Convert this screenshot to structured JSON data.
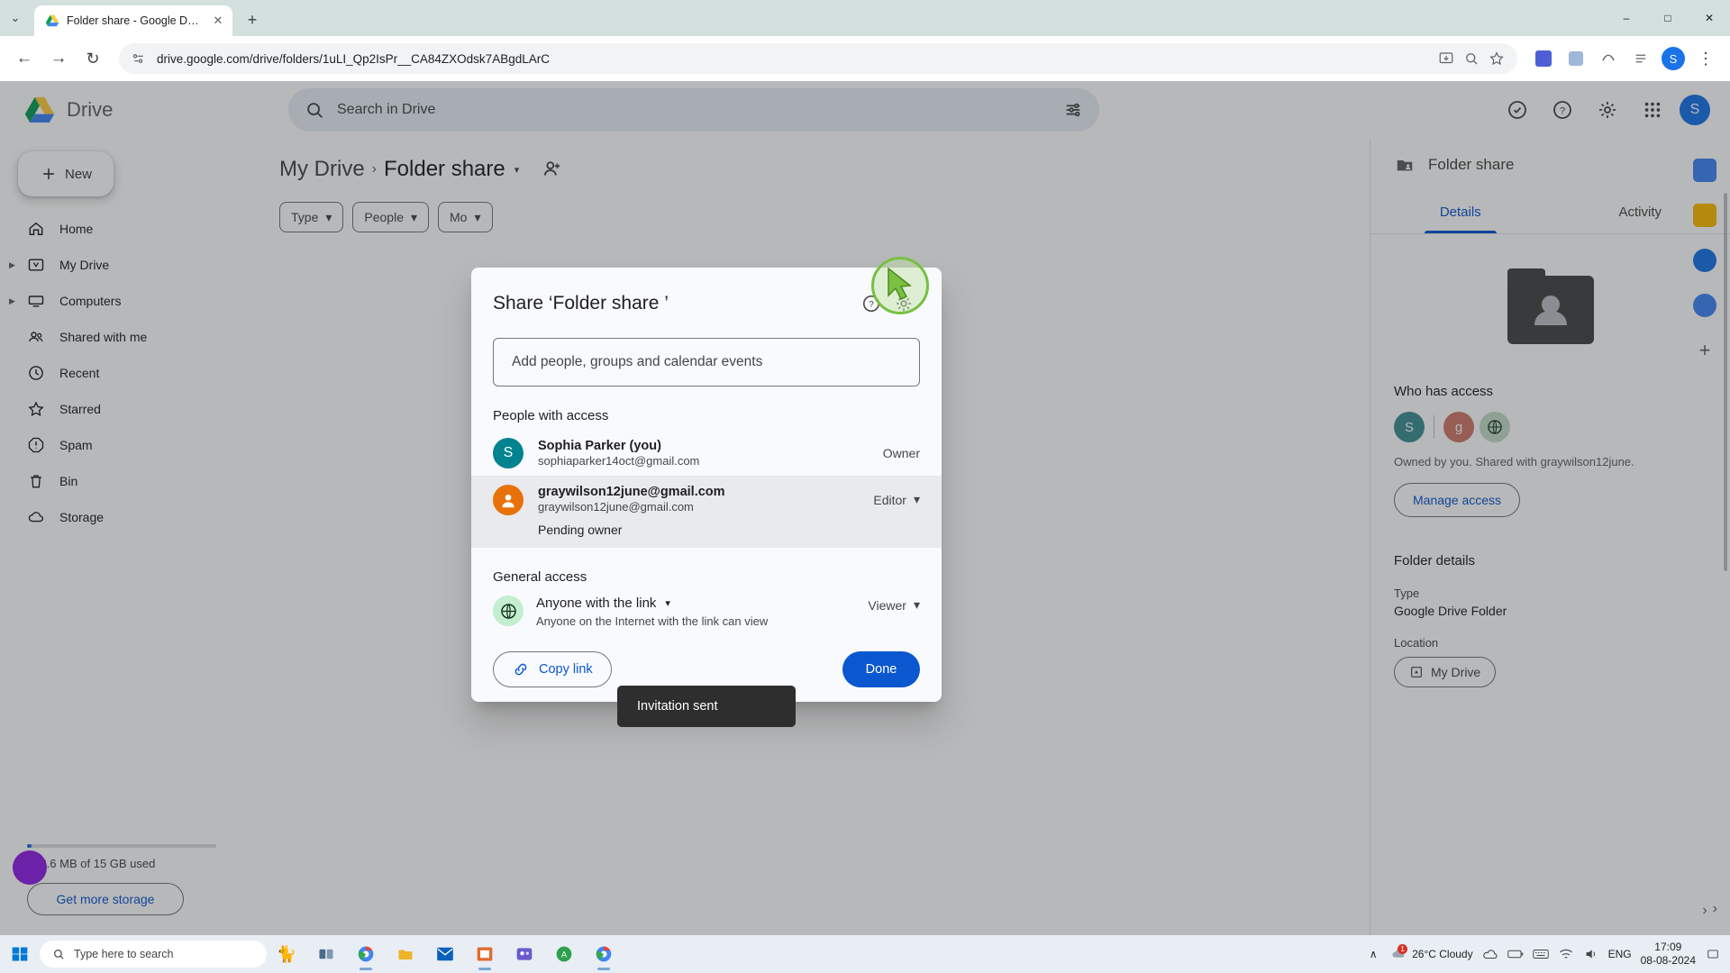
{
  "browser": {
    "tab": {
      "title": "Folder share - Google Drive",
      "favicon": "google-drive-icon",
      "close": "✕"
    },
    "new_tab": "+",
    "tab_list_chevron": "⌄",
    "window_controls": {
      "minimize": "–",
      "maximize": "□",
      "close": "✕"
    },
    "nav": {
      "back": "←",
      "forward": "→",
      "reload": "↻"
    },
    "url": "drive.google.com/drive/folders/1uLI_Qp2IsPr__CA84ZXOdsk7ABgdLArC",
    "profile_initial": "S"
  },
  "drive": {
    "app_name": "Drive",
    "search": {
      "placeholder": "Search in Drive",
      "icon": "search-icon",
      "tune_icon": "tune-icon"
    },
    "header_icons": [
      "support-icon",
      "help-icon",
      "settings-icon",
      "apps-grid-icon"
    ],
    "new_button": "New",
    "sidebar": [
      {
        "label": "Home",
        "icon": "home-icon",
        "expandable": false
      },
      {
        "label": "My Drive",
        "icon": "drive-icon",
        "expandable": true
      },
      {
        "label": "Computers",
        "icon": "computer-icon",
        "expandable": true
      },
      {
        "label": "Shared with me",
        "icon": "people-icon",
        "expandable": false
      },
      {
        "label": "Recent",
        "icon": "clock-icon",
        "expandable": false
      },
      {
        "label": "Starred",
        "icon": "star-icon",
        "expandable": false
      },
      {
        "label": "Spam",
        "icon": "spam-icon",
        "expandable": false
      },
      {
        "label": "Bin",
        "icon": "trash-icon",
        "expandable": false
      },
      {
        "label": "Storage",
        "icon": "cloud-icon",
        "expandable": false
      }
    ],
    "storage": {
      "text": "318.6 MB of 15 GB used",
      "button": "Get more storage",
      "percent": 2
    },
    "breadcrumb": {
      "root": "My Drive",
      "separator": "›",
      "current": "Folder share",
      "caret": "▾",
      "shared_icon": "person-add-icon"
    },
    "chips": [
      {
        "label": "Type",
        "caret": "▾"
      },
      {
        "label": "People",
        "caret": "▾"
      },
      {
        "label": "Mo",
        "caret": "▾"
      }
    ],
    "view": {
      "list_icon": "list-view-icon",
      "grid_icon": "grid-view-icon",
      "check_icon": "check-icon",
      "info_icon": "info-icon"
    }
  },
  "details_panel": {
    "title": "Folder share",
    "folder_icon": "shared-folder-icon",
    "close": "✕",
    "tabs": [
      {
        "label": "Details",
        "active": true
      },
      {
        "label": "Activity",
        "active": false
      }
    ],
    "who_has_access": {
      "heading": "Who has access",
      "faces": [
        {
          "initial": "S",
          "color": "#3f9094"
        },
        {
          "initial": "g",
          "color": "#d2796a"
        },
        {
          "initial": "",
          "color": "#c4ddc9",
          "icon": "globe-icon"
        }
      ],
      "summary": "Owned by you. Shared with graywilson12june.",
      "button": "Manage access"
    },
    "folder_details": {
      "heading": "Folder details",
      "fields": [
        {
          "label": "Type",
          "value": "Google Drive Folder"
        },
        {
          "label": "Location",
          "value": "My Drive",
          "icon": "drive-icon"
        }
      ]
    },
    "more": "›"
  },
  "share_dialog": {
    "title": "Share ‘Folder share ’",
    "help_icon": "help-icon",
    "settings_icon": "gear-icon",
    "add_people": {
      "placeholder": "Add people, groups and calendar events"
    },
    "people_heading": "People with access",
    "people": [
      {
        "name": "Sophia Parker (you)",
        "email": "sophiaparker14oct@gmail.com",
        "role": "Owner",
        "role_has_caret": false,
        "avatar_initial": "S",
        "avatar_color": "#00838f",
        "selected": false,
        "status": ""
      },
      {
        "name": "graywilson12june@gmail.com",
        "email": "graywilson12june@gmail.com",
        "role": "Editor",
        "role_has_caret": true,
        "role_caret": "▾",
        "avatar_initial": "",
        "avatar_color": "#e8710a",
        "avatar_icon": "person-icon",
        "selected": true,
        "status": "Pending owner"
      }
    ],
    "general_heading": "General access",
    "general_access": {
      "icon": "globe-icon",
      "value": "Anyone with the link",
      "caret": "▾",
      "description": "Anyone on the Internet with the link can view",
      "permission": "Viewer",
      "permission_caret": "▾"
    },
    "copy_link": {
      "label": "Copy link",
      "icon": "link-icon"
    },
    "done": "Done",
    "toast": "Invitation sent"
  },
  "taskbar": {
    "start_icon": "windows-icon",
    "search": {
      "placeholder": "Type here to search",
      "icon": "search-icon"
    },
    "apps": [
      "cat-icon",
      "task-view-icon",
      "chrome-icon",
      "explorer-icon",
      "mail-icon",
      "store-icon",
      "teams-icon",
      "antivirus-icon",
      "chrome-2-icon"
    ],
    "tray": {
      "chevron": "∧",
      "weather": "26°C  Cloudy",
      "weather_badge": "1",
      "language": "ENG",
      "time": "17:09",
      "date": "08-08-2024"
    }
  }
}
